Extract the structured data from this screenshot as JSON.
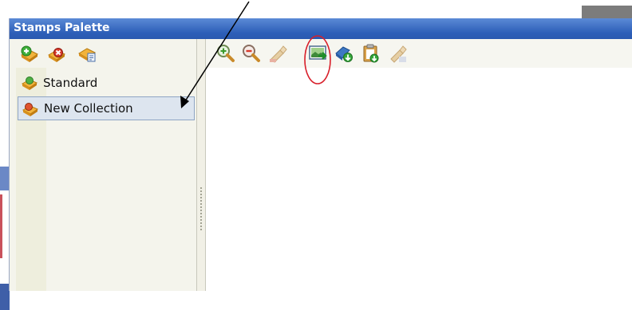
{
  "window": {
    "title": "Stamps Palette"
  },
  "left_toolbar": {
    "buttons": [
      {
        "icon": "add-collection-icon"
      },
      {
        "icon": "delete-collection-icon"
      },
      {
        "icon": "collection-properties-icon"
      }
    ]
  },
  "collections": [
    {
      "label": "Standard",
      "icon": "collection-icon",
      "selected": false
    },
    {
      "label": "New Collection",
      "icon": "collection-icon",
      "selected": true
    }
  ],
  "right_toolbar": {
    "buttons": [
      {
        "icon": "zoom-in-icon"
      },
      {
        "icon": "zoom-out-icon"
      },
      {
        "icon": "stamp-disabled-icon"
      },
      {
        "icon": "import-image-icon",
        "highlighted": true
      },
      {
        "icon": "import-stamp-icon"
      },
      {
        "icon": "paste-stamp-icon"
      },
      {
        "icon": "stamp-properties-disabled-icon"
      }
    ]
  },
  "colors": {
    "titlebar": "#2d5fb8",
    "selection": "#dde5ef",
    "annotation_circle": "#d81f2a"
  }
}
